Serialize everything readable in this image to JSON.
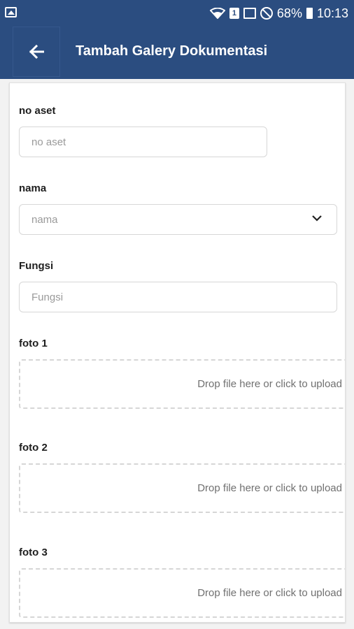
{
  "status_bar": {
    "battery_percent": "68%",
    "time": "10:13",
    "sim_slot": "1"
  },
  "app_bar": {
    "title": "Tambah Galery Dokumentasi",
    "back_icon": "arrow-left-icon"
  },
  "form": {
    "no_aset": {
      "label": "no aset",
      "placeholder": "no aset",
      "value": ""
    },
    "nama": {
      "label": "nama",
      "placeholder": "nama",
      "value": ""
    },
    "fungsi": {
      "label": "Fungsi",
      "placeholder": "Fungsi",
      "value": ""
    },
    "foto1": {
      "label": "foto 1",
      "dropzone_text": "Drop file here or click to upload"
    },
    "foto2": {
      "label": "foto 2",
      "dropzone_text": "Drop file here or click to upload"
    },
    "foto3": {
      "label": "foto 3",
      "dropzone_text": "Drop file here or click to upload"
    }
  },
  "colors": {
    "primary": "#2b4d80",
    "placeholder": "#9a9a9a"
  }
}
